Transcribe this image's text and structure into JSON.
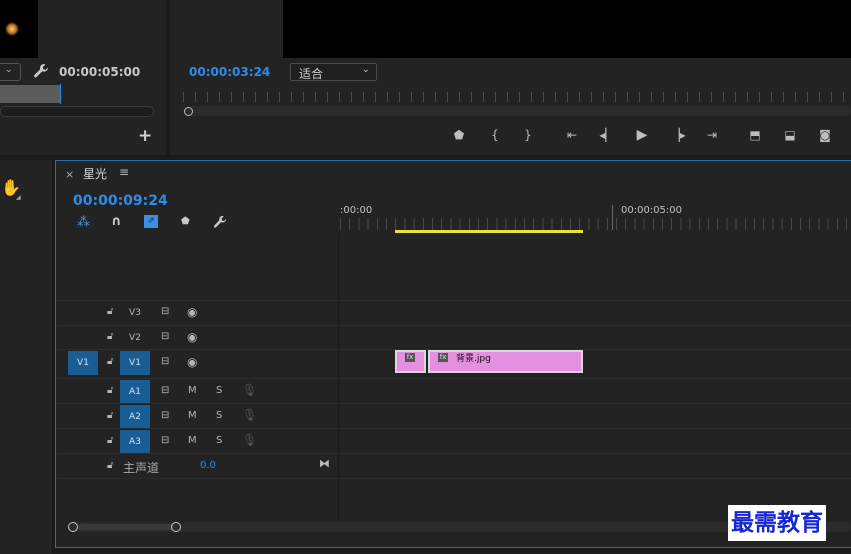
{
  "source_monitor": {
    "timecode": "00:00:05:00",
    "add_button": "+"
  },
  "program_monitor": {
    "timecode": "00:00:03:24",
    "zoom_select": "适合"
  },
  "timeline": {
    "close": "×",
    "title": "星光",
    "menu": "≡",
    "timecode": "00:00:09:24",
    "ruler_labels": [
      ":00:00",
      "00:00:05:00"
    ],
    "video_tracks": [
      {
        "label": "V3",
        "source": ""
      },
      {
        "label": "V2",
        "source": ""
      },
      {
        "label": "V1",
        "source": "V1"
      }
    ],
    "audio_tracks": [
      {
        "label": "A1",
        "m": "M",
        "s": "S"
      },
      {
        "label": "A2",
        "m": "M",
        "s": "S"
      },
      {
        "label": "A3",
        "m": "M",
        "s": "S"
      }
    ],
    "master": {
      "label": "主声道",
      "value": "0.0"
    },
    "clip": {
      "fx": "fx",
      "name": "背景.jpg",
      "color": "#e58fe0"
    }
  },
  "watermark": "最需教育",
  "colors": {
    "accent": "#2d8ceb",
    "clip": "#e58fe0",
    "work_area": "#e8e23a"
  }
}
